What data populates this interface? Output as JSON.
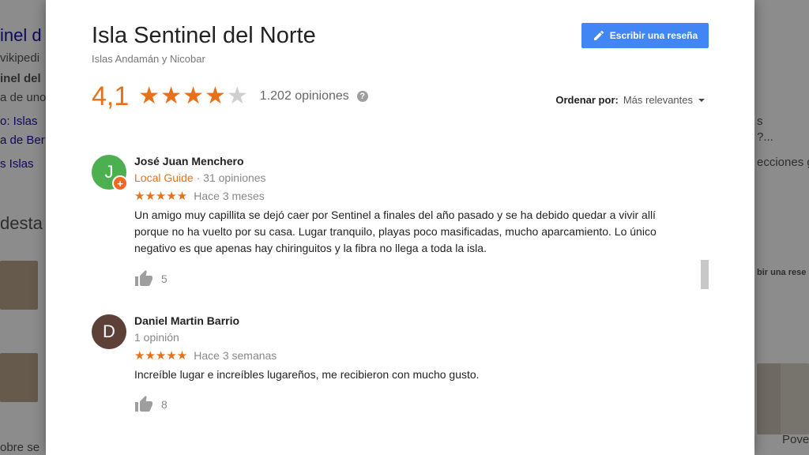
{
  "background": {
    "left_fragments": [
      "inel d",
      "vikipedi",
      "inel del",
      "a de uno",
      "o: Islas",
      "a de Ber",
      "s   Islas",
      "desta",
      "obre se"
    ],
    "right_fragments": [
      "s",
      "?...",
      "ecciones g",
      "bir una rese",
      "Pove"
    ]
  },
  "dialog": {
    "title": "Isla Sentinel del Norte",
    "subtitle": "Islas Andamán y Nicobar",
    "write_review_label": "Escribir una reseña",
    "rating_value": "4,1",
    "rating_fraction": 0.82,
    "review_count": "1.202 opiniones",
    "sort_label": "Ordenar por:",
    "sort_value": "Más relevantes"
  },
  "reviews": [
    {
      "avatar_letter": "J",
      "avatar_color": "#4caf50",
      "name": "José Juan Menchero",
      "guide_label": "Local Guide",
      "meta": " · 31 opiniones",
      "stars": "★★★★★",
      "time": "Hace 3 meses",
      "text": "Un amigo muy capillita se dejó caer por Sentinel a finales del año pasado y se ha debido quedar a vivir allí porque no ha vuelto por su casa. Lugar tranquilo, playas poco masificadas, mucho aparcamiento. Lo único negativo es que apenas hay chiringuitos y la fibra no llega a toda la isla.",
      "likes": "5"
    },
    {
      "avatar_letter": "D",
      "avatar_color": "#5d4037",
      "name": "Daniel Martin Barrio",
      "guide_label": "",
      "meta": "1 opinión",
      "stars": "★★★★★",
      "time": "Hace 3 semanas",
      "text": "Increíble lugar e increíbles lugareños, me recibieron con mucho gusto.",
      "likes": "8"
    }
  ],
  "colors": {
    "accent_orange": "#e7711b",
    "button_blue": "#4285f4"
  },
  "icons": [
    "pencil-icon",
    "star-icon",
    "help-icon",
    "caret-down-icon",
    "thumbs-up-icon",
    "local-guide-badge-icon"
  ]
}
